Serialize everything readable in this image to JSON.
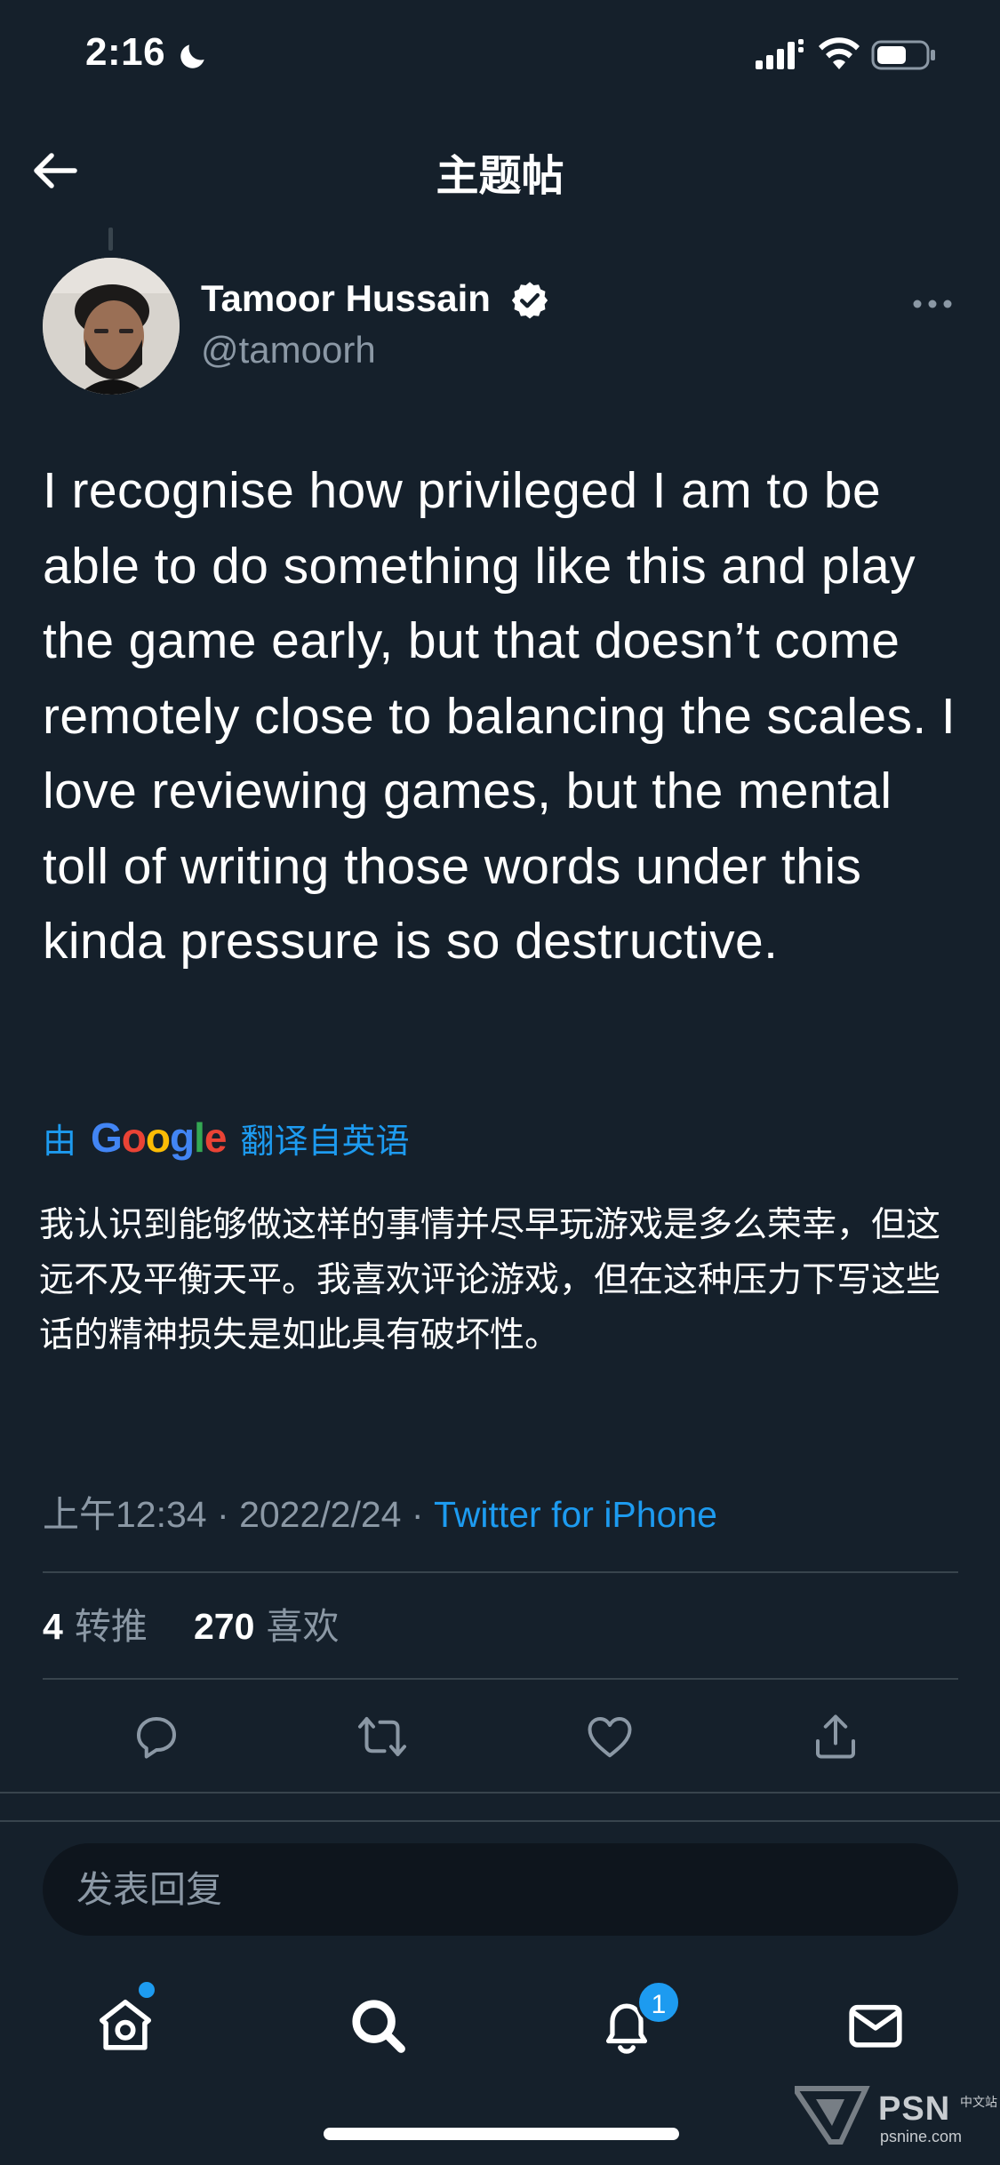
{
  "status_bar": {
    "time": "2:16"
  },
  "header": {
    "title": "主题帖"
  },
  "author": {
    "name": "Tamoor Hussain",
    "handle": "@tamoorh"
  },
  "tweet": {
    "text": "I recognise how privileged I am to be able to do something like this and play the game early, but that doesn’t come remotely close to balancing the scales. I love reviewing games, but the mental toll of writing those words under this kinda pressure is so destructive.",
    "translate_prefix": "由",
    "translate_brand": "Google",
    "translate_suffix": "翻译自英语",
    "translated_text": "我认识到能够做这样的事情并尽早玩游戏是多么荣幸，但这远不及平衡天平。我喜欢评论游戏，但在这种压力下写这些话的精神损失是如此具有破坏性。",
    "time": "上午12:34",
    "separator": "·",
    "date": "2022/2/24",
    "source": "Twitter for iPhone"
  },
  "stats": {
    "retweets_count": "4",
    "retweets_label": "转推",
    "likes_count": "270",
    "likes_label": "喜欢"
  },
  "reply": {
    "placeholder": "发表回复"
  },
  "bottom_nav": {
    "notification_badge": "1"
  },
  "watermark": {
    "brand": "PSN",
    "brand_sub": "中文站",
    "url": "psnine.com"
  },
  "colors": {
    "background": "#15202b",
    "accent": "#1d9bf0",
    "secondary_text": "#8b98a5",
    "divider": "#38444d"
  }
}
